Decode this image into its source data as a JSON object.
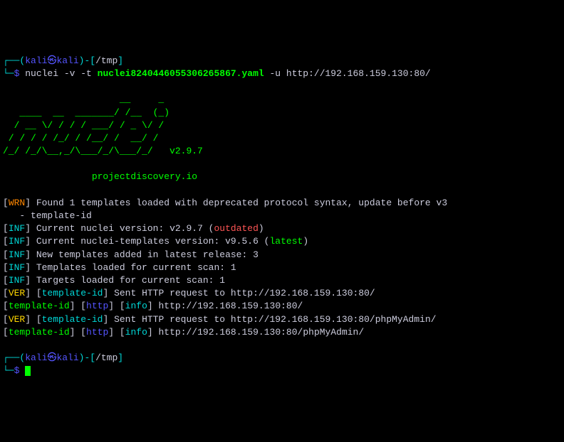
{
  "prompt1": {
    "box_open": "┌──(",
    "user": "kali",
    "sep": "㉿",
    "host": "kali",
    "box_mid": ")-[",
    "path": "/tmp",
    "box_close": "]",
    "line2_prefix": "└─",
    "dollar": "$",
    "cmd_prefix": " nuclei -v -t ",
    "cmd_file": "nuclei8240446055306265867.yaml",
    "cmd_suffix": " -u http://192.168.159.130:80/"
  },
  "ascii_logo": "                     __     _\n   ____  __  _______/ /__  (_)\n  / __ \\/ / / / ___/ / _ \\/ /\n / / / / /_/ / /__/ /  __/ /\n/_/ /_/\\__,_/\\___/_/\\___/_/   v2.9.7",
  "tagline": "                projectdiscovery.io",
  "wrn": {
    "tag": "WRN",
    "text": " Found 1 templates loaded with deprecated protocol syntax, update before v3",
    "sub": "   - template-id"
  },
  "inf1": {
    "tag": "INF",
    "text_a": " Current nuclei version: v2.9.7 (",
    "outdated": "outdated",
    "text_b": ")"
  },
  "inf2": {
    "tag": "INF",
    "text_a": " Current nuclei-templates version: v9.5.6 (",
    "latest": "latest",
    "text_b": ")"
  },
  "inf3": {
    "tag": "INF",
    "text": " New templates added in latest release: 3"
  },
  "inf4": {
    "tag": "INF",
    "text": " Templates loaded for current scan: 1"
  },
  "inf5": {
    "tag": "INF",
    "text": " Targets loaded for current scan: 1"
  },
  "ver1": {
    "tag": "VER",
    "tid": "template-id",
    "text": " Sent HTTP request to http://192.168.159.130:80/"
  },
  "res1": {
    "tid": "template-id",
    "proto": "http",
    "sev": "info",
    "url": " http://192.168.159.130:80/"
  },
  "ver2": {
    "tag": "VER",
    "tid": "template-id",
    "text": " Sent HTTP request to http://192.168.159.130:80/phpMyAdmin/"
  },
  "res2": {
    "tid": "template-id",
    "proto": "http",
    "sev": "info",
    "url": " http://192.168.159.130:80/phpMyAdmin/"
  },
  "prompt2": {
    "box_open": "┌──(",
    "user": "kali",
    "sep": "㉿",
    "host": "kali",
    "box_mid": ")-[",
    "path": "/tmp",
    "box_close": "]",
    "line2_prefix": "└─",
    "dollar": "$"
  }
}
